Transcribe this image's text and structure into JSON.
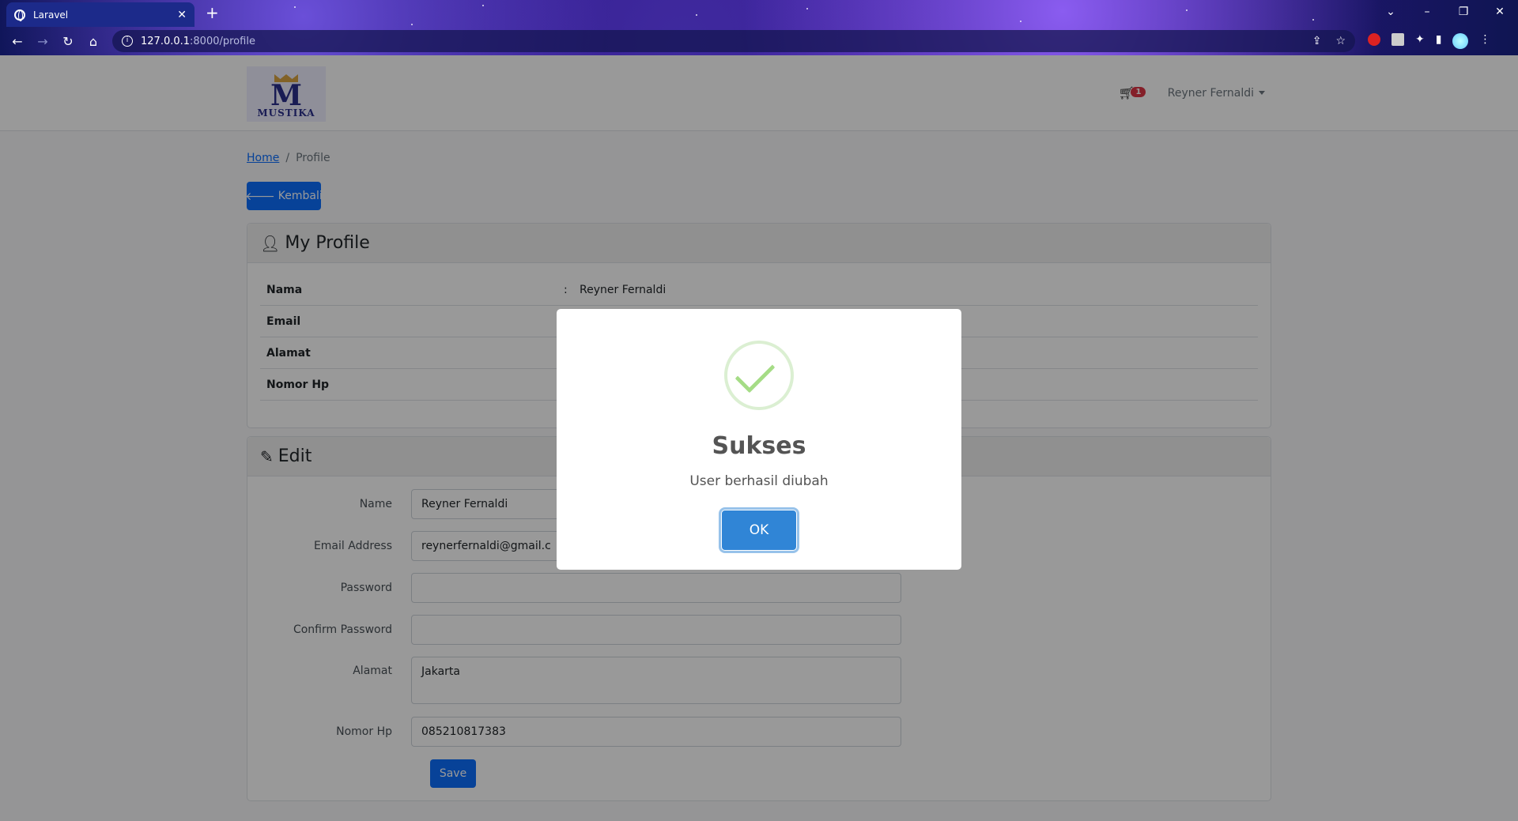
{
  "browser": {
    "tab_title": "Laravel",
    "url_host": "127.0.0.1",
    "url_path": ":8000/profile"
  },
  "navbar": {
    "logo_text": "MUSTIKA",
    "cart_count": "1",
    "user_name": "Reyner Fernaldi"
  },
  "breadcrumb": {
    "home": "Home",
    "current": "Profile"
  },
  "back_button": "Kembali",
  "profile": {
    "header": "My Profile",
    "rows": [
      {
        "label": "Nama",
        "sep": ":",
        "value": "Reyner Fernaldi"
      },
      {
        "label": "Email",
        "sep": "",
        "value": ""
      },
      {
        "label": "Alamat",
        "sep": "",
        "value": ""
      },
      {
        "label": "Nomor Hp",
        "sep": "",
        "value": ""
      }
    ]
  },
  "edit": {
    "header": "Edit",
    "fields": [
      {
        "label": "Name",
        "value": "Reyner Fernaldi"
      },
      {
        "label": "Email Address",
        "value": "reynerfernaldi@gmail.c"
      },
      {
        "label": "Password",
        "value": ""
      },
      {
        "label": "Confirm Password",
        "value": ""
      },
      {
        "label": "Alamat",
        "value": "Jakarta"
      },
      {
        "label": "Nomor Hp",
        "value": "085210817383"
      }
    ],
    "save_label": "Save"
  },
  "alert": {
    "title": "Sukses",
    "text": "User berhasil diubah",
    "ok_label": "OK"
  },
  "colors": {
    "primary": "#0d6efd",
    "danger": "#dc3545",
    "success_tick": "#a5dc86",
    "ok_button": "#3085d6"
  }
}
